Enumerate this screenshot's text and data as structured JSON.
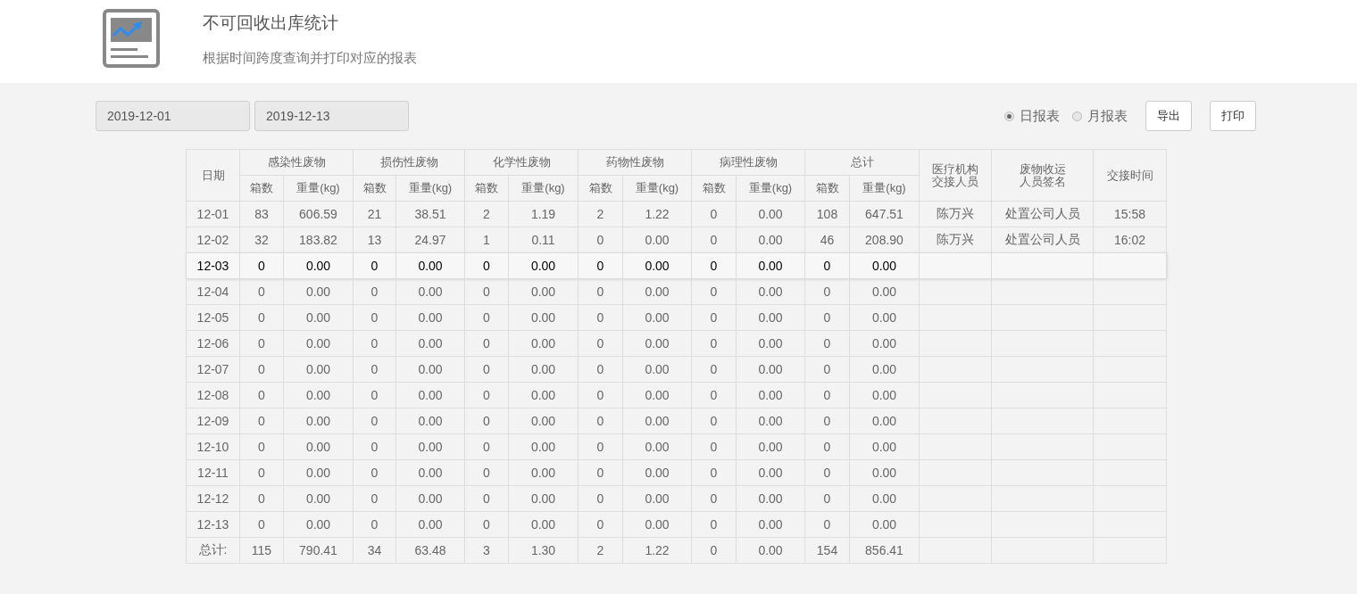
{
  "header": {
    "title": "不可回收出库统计",
    "subtitle": "根据时间跨度查询并打印对应的报表"
  },
  "filters": {
    "start_date": "2019-12-01",
    "end_date": "2019-12-13"
  },
  "report_types": [
    {
      "label": "日报表",
      "selected": true
    },
    {
      "label": "月报表",
      "selected": false
    }
  ],
  "buttons": [
    "导出",
    "打印"
  ],
  "table": {
    "date_header": "日期",
    "groups": [
      {
        "label": "感染性废物",
        "sub_columns": [
          "箱数",
          "重量(kg)"
        ]
      },
      {
        "label": "损伤性废物",
        "sub_columns": [
          "箱数",
          "重量(kg)"
        ]
      },
      {
        "label": "化学性废物",
        "sub_columns": [
          "箱数",
          "重量(kg)"
        ]
      },
      {
        "label": "药物性废物",
        "sub_columns": [
          "箱数",
          "重量(kg)"
        ]
      },
      {
        "label": "病理性废物",
        "sub_columns": [
          "箱数",
          "重量(kg)"
        ]
      },
      {
        "label": "总计",
        "sub_columns": [
          "箱数",
          "重量(kg)"
        ]
      }
    ],
    "extra_columns": [
      "医疗机构交接人员",
      "废物收运人员签名",
      "交接时间"
    ],
    "rows": [
      {
        "date": "12-01",
        "values": [
          "83",
          "606.59",
          "21",
          "38.51",
          "2",
          "1.19",
          "2",
          "1.22",
          "0",
          "0.00",
          "108",
          "647.51"
        ],
        "extra": [
          "陈万兴",
          "处置公司人员",
          "15:58"
        ],
        "highlighted": false
      },
      {
        "date": "12-02",
        "values": [
          "32",
          "183.82",
          "13",
          "24.97",
          "1",
          "0.11",
          "0",
          "0.00",
          "0",
          "0.00",
          "46",
          "208.90"
        ],
        "extra": [
          "陈万兴",
          "处置公司人员",
          "16:02"
        ],
        "highlighted": false
      },
      {
        "date": "12-03",
        "values": [
          "0",
          "0.00",
          "0",
          "0.00",
          "0",
          "0.00",
          "0",
          "0.00",
          "0",
          "0.00",
          "0",
          "0.00"
        ],
        "extra": [],
        "highlighted": true
      },
      {
        "date": "12-04",
        "values": [
          "0",
          "0.00",
          "0",
          "0.00",
          "0",
          "0.00",
          "0",
          "0.00",
          "0",
          "0.00",
          "0",
          "0.00"
        ],
        "extra": [],
        "highlighted": false
      },
      {
        "date": "12-05",
        "values": [
          "0",
          "0.00",
          "0",
          "0.00",
          "0",
          "0.00",
          "0",
          "0.00",
          "0",
          "0.00",
          "0",
          "0.00"
        ],
        "extra": [],
        "highlighted": false
      },
      {
        "date": "12-06",
        "values": [
          "0",
          "0.00",
          "0",
          "0.00",
          "0",
          "0.00",
          "0",
          "0.00",
          "0",
          "0.00",
          "0",
          "0.00"
        ],
        "extra": [],
        "highlighted": false
      },
      {
        "date": "12-07",
        "values": [
          "0",
          "0.00",
          "0",
          "0.00",
          "0",
          "0.00",
          "0",
          "0.00",
          "0",
          "0.00",
          "0",
          "0.00"
        ],
        "extra": [],
        "highlighted": false
      },
      {
        "date": "12-08",
        "values": [
          "0",
          "0.00",
          "0",
          "0.00",
          "0",
          "0.00",
          "0",
          "0.00",
          "0",
          "0.00",
          "0",
          "0.00"
        ],
        "extra": [],
        "highlighted": false
      },
      {
        "date": "12-09",
        "values": [
          "0",
          "0.00",
          "0",
          "0.00",
          "0",
          "0.00",
          "0",
          "0.00",
          "0",
          "0.00",
          "0",
          "0.00"
        ],
        "extra": [],
        "highlighted": false
      },
      {
        "date": "12-10",
        "values": [
          "0",
          "0.00",
          "0",
          "0.00",
          "0",
          "0.00",
          "0",
          "0.00",
          "0",
          "0.00",
          "0",
          "0.00"
        ],
        "extra": [],
        "highlighted": false
      },
      {
        "date": "12-11",
        "values": [
          "0",
          "0.00",
          "0",
          "0.00",
          "0",
          "0.00",
          "0",
          "0.00",
          "0",
          "0.00",
          "0",
          "0.00"
        ],
        "extra": [],
        "highlighted": false
      },
      {
        "date": "12-12",
        "values": [
          "0",
          "0.00",
          "0",
          "0.00",
          "0",
          "0.00",
          "0",
          "0.00",
          "0",
          "0.00",
          "0",
          "0.00"
        ],
        "extra": [],
        "highlighted": false
      },
      {
        "date": "12-13",
        "values": [
          "0",
          "0.00",
          "0",
          "0.00",
          "0",
          "0.00",
          "0",
          "0.00",
          "0",
          "0.00",
          "0",
          "0.00"
        ],
        "extra": [],
        "highlighted": false
      },
      {
        "date": "总计:",
        "values": [
          "115",
          "790.41",
          "34",
          "63.48",
          "3",
          "1.30",
          "2",
          "1.22",
          "0",
          "0.00",
          "154",
          "856.41"
        ],
        "extra": [],
        "highlighted": false
      }
    ]
  }
}
